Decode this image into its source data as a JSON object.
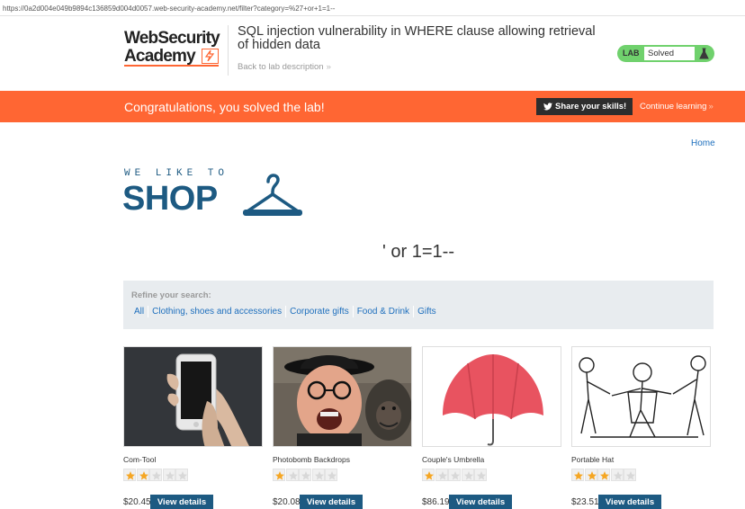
{
  "browser": {
    "url": "https://0a2d004e049b9894c136859d004d0057.web-security-academy.net/filter?category=%27+or+1=1--"
  },
  "header": {
    "logo_line1": "WebSecurity",
    "logo_line2": "Academy",
    "lab_title": "SQL injection vulnerability in WHERE clause allowing retrieval of hidden data",
    "back_link": "Back to lab description",
    "back_chevron": "»",
    "status_tag": "LAB",
    "status_label": "Solved",
    "status_icon": "flask-icon"
  },
  "banner": {
    "message": "Congratulations, you solved the lab!",
    "share_label": "Share your skills!",
    "share_icon": "twitter-icon",
    "continue_label": "Continue learning",
    "continue_chevron": "»",
    "color": "#ff6633"
  },
  "nav": {
    "home": "Home"
  },
  "shop_logo": {
    "tagline": "WE LIKE TO",
    "name": "SHOP",
    "icon": "hanger-icon"
  },
  "page_heading": "' or 1=1--",
  "filter": {
    "refine_label": "Refine your search:",
    "categories": [
      "All",
      "Clothing, shoes and accessories",
      "Corporate gifts",
      "Food & Drink",
      "Gifts"
    ]
  },
  "products": [
    {
      "name": "Com-Tool",
      "rating": 2,
      "max_rating": 5,
      "price": "$20.45",
      "button": "View details"
    },
    {
      "name": "Photobomb Backdrops",
      "rating": 1,
      "max_rating": 5,
      "price": "$20.08",
      "button": "View details"
    },
    {
      "name": "Couple's Umbrella",
      "rating": 1,
      "max_rating": 5,
      "price": "$86.19",
      "button": "View details"
    },
    {
      "name": "Portable Hat",
      "rating": 3,
      "max_rating": 5,
      "price": "$23.51",
      "button": "View details"
    }
  ],
  "colors": {
    "accent": "#ff6633",
    "brand_blue": "#1d5a82",
    "link": "#1e6fbd",
    "solved_green": "#70d16d",
    "star": "#f5a623"
  }
}
